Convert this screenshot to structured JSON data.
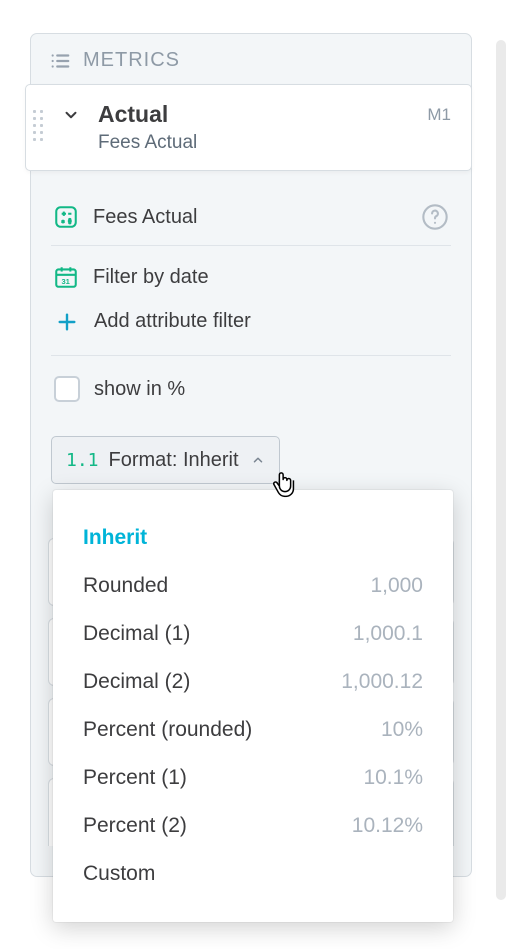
{
  "panel": {
    "title": "METRICS"
  },
  "metric": {
    "title": "Actual",
    "subtitle": "Fees Actual",
    "tag": "M1"
  },
  "details": {
    "name": "Fees Actual",
    "filter_date": "Filter by date",
    "add_filter": "Add attribute filter",
    "show_percent": "show in %"
  },
  "format_button": {
    "prefix": "1.1",
    "label": "Format: Inherit"
  },
  "dropdown": {
    "items": [
      {
        "label": "Inherit",
        "sample": "",
        "selected": true
      },
      {
        "label": "Rounded",
        "sample": "1,000"
      },
      {
        "label": "Decimal (1)",
        "sample": "1,000.1"
      },
      {
        "label": "Decimal (2)",
        "sample": "1,000.12"
      },
      {
        "label": "Percent (rounded)",
        "sample": "10%"
      },
      {
        "label": "Percent (1)",
        "sample": "10.1%"
      },
      {
        "label": "Percent (2)",
        "sample": "10.12%"
      },
      {
        "label": "Custom",
        "sample": ""
      }
    ]
  }
}
